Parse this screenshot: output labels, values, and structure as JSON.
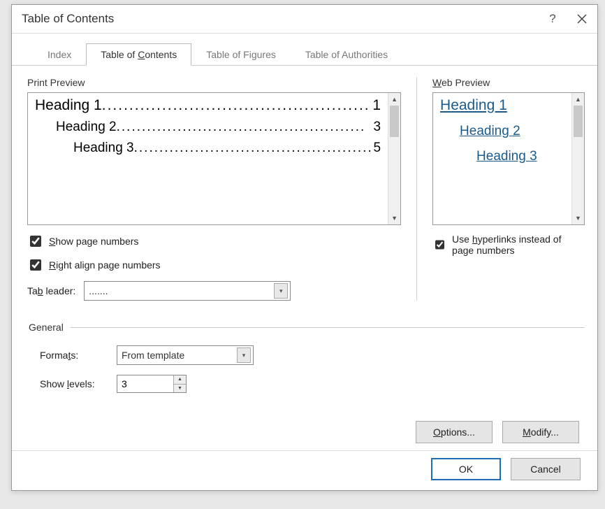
{
  "dialog": {
    "title": "Table of Contents"
  },
  "tabs": {
    "index": "Index",
    "toc_pre": "Table of ",
    "toc_u": "C",
    "toc_post": "ontents",
    "figures": "Table of Figures",
    "authorities": "Table of Authorities"
  },
  "print_preview": {
    "label": "Print Preview",
    "rows": [
      {
        "text": "Heading 1",
        "page": "1"
      },
      {
        "text": "Heading 2",
        "page": "3"
      },
      {
        "text": "Heading 3",
        "page": "5"
      }
    ]
  },
  "web_preview": {
    "label_u": "W",
    "label_post": "eb Preview",
    "rows": [
      {
        "text": "Heading 1"
      },
      {
        "text": "Heading 2"
      },
      {
        "text": "Heading 3"
      }
    ]
  },
  "checks": {
    "show_pn_u": "S",
    "show_pn_post": "how page numbers",
    "right_align_u": "R",
    "right_align_post": "ight align page numbers",
    "hyperlinks_pre": "Use ",
    "hyperlinks_u": "h",
    "hyperlinks_post": "yperlinks instead of page numbers"
  },
  "tab_leader": {
    "label_pre": "Ta",
    "label_u": "b",
    "label_post": " leader:",
    "value": "......."
  },
  "general": {
    "legend": "General",
    "formats_label_pre": "Forma",
    "formats_label_u": "t",
    "formats_label_post": "s:",
    "formats_value": "From template",
    "levels_label_pre": "Show ",
    "levels_label_u": "l",
    "levels_label_post": "evels:",
    "levels_value": "3"
  },
  "buttons": {
    "options_u": "O",
    "options_post": "ptions...",
    "modify_u": "M",
    "modify_post": "odify...",
    "ok": "OK",
    "cancel": "Cancel"
  }
}
